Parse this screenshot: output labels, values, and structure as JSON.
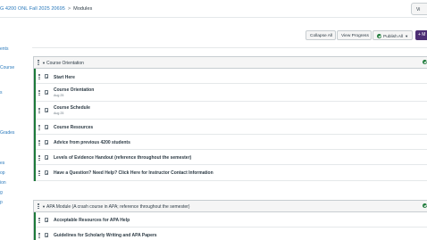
{
  "header": {
    "course": "G 4200 ONL Fall 2025 20695",
    "separator": ">",
    "current": "Modules",
    "right_button": "Vi"
  },
  "nav": {
    "items": [
      "ents",
      "Course",
      "s",
      "Grades",
      "es",
      "op",
      "ion",
      "g",
      "p"
    ]
  },
  "toolbar": {
    "collapse_all": "Collapse All",
    "view_progress": "View Progress",
    "publish_all": "Publish All",
    "add_module": "+ M"
  },
  "colors": {
    "published": "#1d7a3a",
    "link": "#2b7abc",
    "add_button": "#4c2e74"
  },
  "modules": [
    {
      "title": "Course Orientation",
      "items": [
        {
          "name": "Start Here",
          "date": ""
        },
        {
          "name": "Course Orientation",
          "date": "Aug 25"
        },
        {
          "name": "Course Schedule",
          "date": "Aug 25"
        },
        {
          "name": "Course Resources",
          "date": ""
        },
        {
          "name": "Advice from previous 4200 students",
          "date": ""
        },
        {
          "name": "Levels of Evidence Handout (reference throughout the semester)",
          "date": ""
        },
        {
          "name": "Have a Question? Need Help? Click Here for Instructor Contact Information",
          "date": ""
        }
      ]
    },
    {
      "title": "APA Module (A crash course in APA; reference throughout the semester)",
      "items": [
        {
          "name": "Acceptable Resources for APA Help",
          "date": ""
        },
        {
          "name": "Guidelines for Scholarly Writing and APA Papers",
          "date": ""
        }
      ]
    }
  ]
}
